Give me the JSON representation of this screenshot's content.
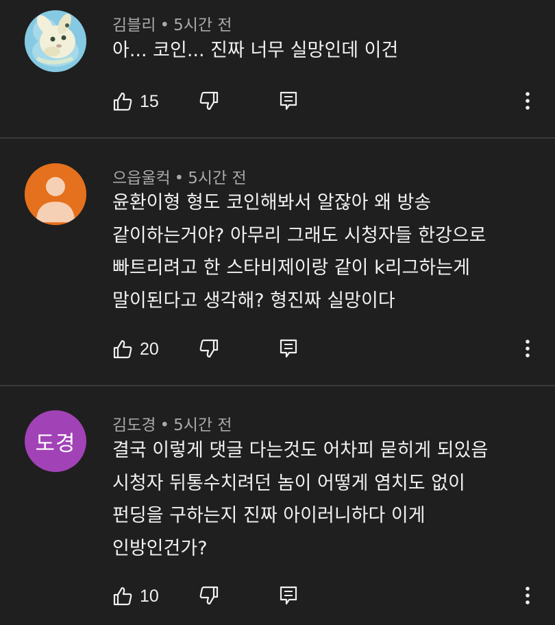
{
  "comments": [
    {
      "author": "김블리",
      "time": "5시간 전",
      "lines": [
        "아... 코인... 진짜 너무 실망인데 이건"
      ],
      "likes": "15",
      "avatar": {
        "type": "image",
        "icon": "bunny-illustration"
      }
    },
    {
      "author": "으읍울컥",
      "time": "5시간 전",
      "lines": [
        "윤환이형 형도 코인해봐서 알잖아 왜 방송",
        "같이하는거야? 아무리 그래도 시청자들 한강으로",
        "빠트리려고 한 스타비제이랑 같이 k리그하는게",
        "말이된다고 생각해? 형진짜 실망이다"
      ],
      "likes": "20",
      "avatar": {
        "type": "default-person",
        "color": "#e5701d"
      }
    },
    {
      "author": "김도경",
      "time": "5시간 전",
      "lines": [
        "결국 이렇게 댓글 다는것도 어차피 묻히게 되있음",
        "시청자 뒤통수치려던 놈이 어떻게 염치도 없이",
        "펀딩을 구하는지 진짜 아이러니하다 이게",
        "인방인건가?"
      ],
      "likes": "10",
      "avatar": {
        "type": "initials",
        "initials": "도경",
        "color": "#a242b7"
      }
    }
  ],
  "separator": "•",
  "colors": {
    "background": "#1f1f1f",
    "text": "#f1f1f1",
    "meta": "#aaaaaa",
    "divider": "#3a3a3a"
  }
}
